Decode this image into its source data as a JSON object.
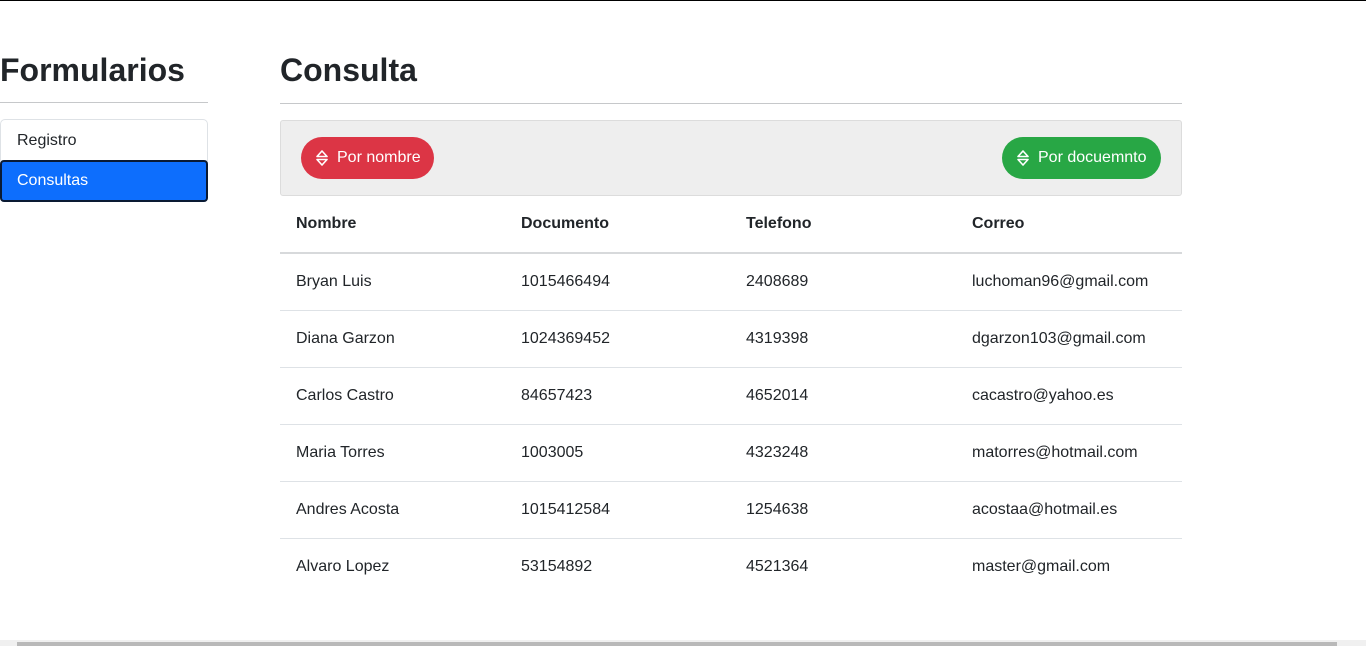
{
  "sidebar": {
    "title": "Formularios",
    "items": [
      {
        "label": "Registro"
      },
      {
        "label": "Consultas"
      }
    ]
  },
  "main": {
    "title": "Consulta",
    "toolbar": {
      "sort_by_name_label": "Por nombre",
      "sort_by_document_label": "Por docuemnto"
    },
    "table": {
      "headers": [
        "Nombre",
        "Documento",
        "Telefono",
        "Correo"
      ],
      "rows": [
        [
          "Bryan Luis",
          "1015466494",
          "2408689",
          "luchoman96@gmail.com"
        ],
        [
          "Diana Garzon",
          "1024369452",
          "4319398",
          "dgarzon103@gmail.com"
        ],
        [
          "Carlos Castro",
          "84657423",
          "4652014",
          "cacastro@yahoo.es"
        ],
        [
          "Maria Torres",
          "1003005",
          "4323248",
          "matorres@hotmail.com"
        ],
        [
          "Andres Acosta",
          "1015412584",
          "1254638",
          "acostaa@hotmail.es"
        ],
        [
          "Alvaro Lopez",
          "53154892",
          "4521364",
          "master@gmail.com"
        ]
      ]
    }
  },
  "colors": {
    "active": "#0d6efd",
    "danger": "#dc3545",
    "success": "#28a745"
  },
  "icons": {
    "sort": "sort-icon"
  }
}
